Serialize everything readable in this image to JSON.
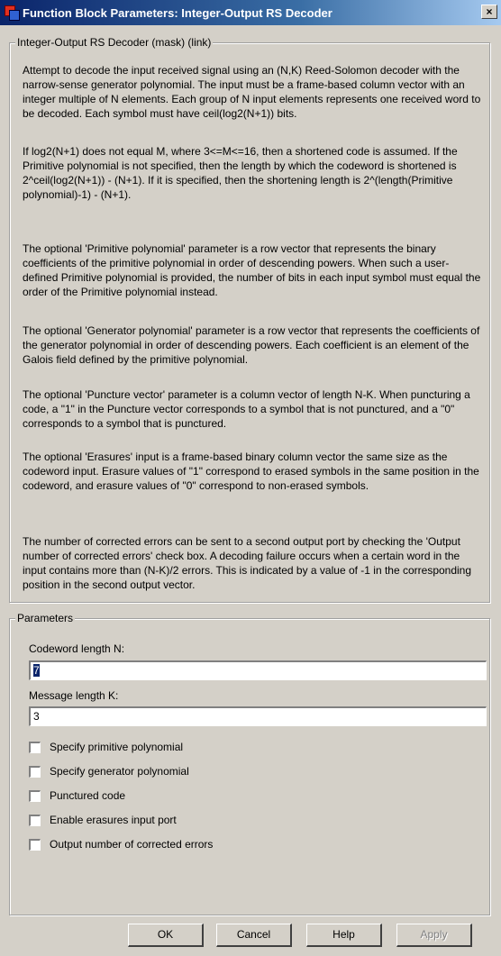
{
  "window": {
    "title": "Function Block Parameters: Integer-Output RS Decoder",
    "close_label": "×"
  },
  "mask": {
    "legend": "Integer-Output RS Decoder (mask) (link)",
    "paragraphs": [
      "Attempt to decode the input received signal using an (N,K) Reed-Solomon decoder with the narrow-sense generator polynomial.  The input must be a frame-based column vector with an integer multiple of N elements.  Each group of N input elements represents one received word to be decoded.  Each symbol must have ceil(log2(N+1)) bits.",
      "If log2(N+1) does not equal M, where 3<=M<=16, then a shortened code is assumed.  If the Primitive polynomial is not specified, then the length by which the codeword is shortened is 2^ceil(log2(N+1)) - (N+1).  If it is specified, then the shortening length is 2^(length(Primitive polynomial)-1) - (N+1).",
      "The optional 'Primitive polynomial' parameter is a row vector that represents the binary coefficients of the primitive polynomial in order of descending powers.  When such a user-defined Primitive polynomial is provided, the number of bits in each input symbol must equal the order of the Primitive polynomial instead.",
      "The optional 'Generator polynomial' parameter is a row vector that represents the coefficients of the generator polynomial in order of descending powers.  Each coefficient is an element of the Galois field defined by the primitive polynomial.",
      "The optional 'Puncture vector' parameter is a column vector of length N-K.  When puncturing a code, a \"1\" in the Puncture vector corresponds to a symbol that is not punctured, and a \"0\" corresponds to a symbol that is punctured.",
      "The optional 'Erasures' input is a frame-based binary column vector the same size as the codeword input.  Erasure values of \"1\" correspond to erased symbols in the same position in the codeword, and erasure values of \"0\" correspond to non-erased symbols.",
      "The number of corrected errors can be sent to a second output port by checking the 'Output number of corrected errors' check box.  A decoding failure occurs when a certain word in the input contains more than (N-K)/2 errors.  This is indicated by a value of -1 in the corresponding position in the second output vector."
    ]
  },
  "parameters": {
    "legend": "Parameters",
    "codeword_label": "Codeword length N:",
    "codeword_value": "7",
    "message_label": "Message length K:",
    "message_value": "3",
    "checkboxes": [
      {
        "label": "Specify primitive polynomial",
        "checked": false
      },
      {
        "label": "Specify generator polynomial",
        "checked": false
      },
      {
        "label": "Punctured code",
        "checked": false
      },
      {
        "label": "Enable erasures input port",
        "checked": false
      },
      {
        "label": "Output number of corrected errors",
        "checked": false
      }
    ]
  },
  "buttons": {
    "ok": "OK",
    "cancel": "Cancel",
    "help": "Help",
    "apply": "Apply"
  }
}
